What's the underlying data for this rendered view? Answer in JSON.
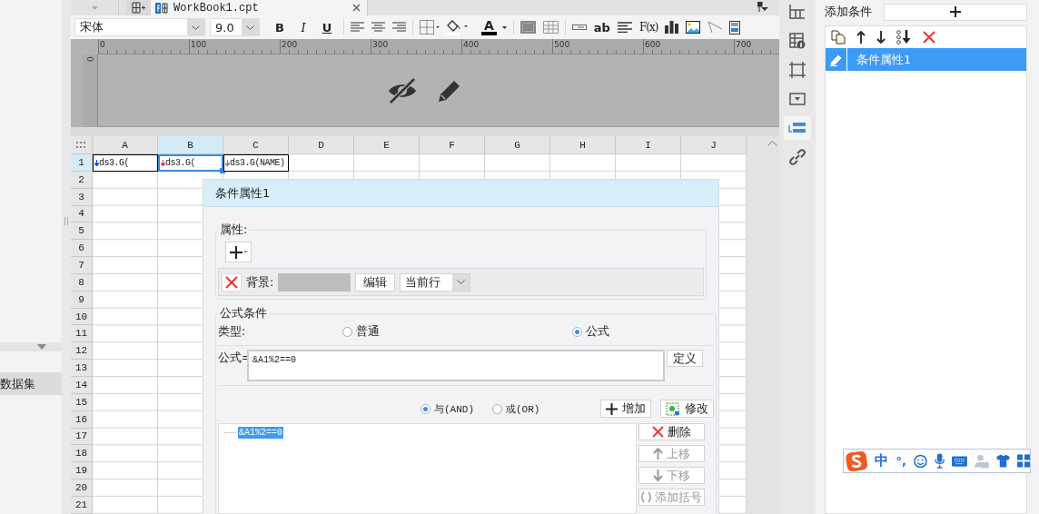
{
  "left_panel": {
    "dataset_label": "数据集"
  },
  "tab_bar": {
    "tabs": [
      {
        "label": "WorkBook1.cpt",
        "selected": true
      }
    ]
  },
  "toolbar": {
    "font": "宋体",
    "font_size": "9.0",
    "format_buttons": [
      {
        "kind": "bold",
        "label": "B"
      },
      {
        "kind": "italic",
        "label": "I"
      },
      {
        "kind": "underline",
        "label": "U"
      }
    ],
    "font_color_label": "A",
    "text_tool_label": "ab",
    "formula_tool_label": "F(x)"
  },
  "ruler": {
    "marks": [
      "0",
      "100",
      "200",
      "300",
      "400",
      "500",
      "600",
      "700"
    ],
    "vertical_mark": "0"
  },
  "sheet": {
    "columns": [
      {
        "label": "A",
        "selected": false
      },
      {
        "label": "B",
        "selected": true
      },
      {
        "label": "C",
        "selected": false
      },
      {
        "label": "D",
        "selected": false
      },
      {
        "label": "E",
        "selected": false
      },
      {
        "label": "F",
        "selected": false
      },
      {
        "label": "G",
        "selected": false
      },
      {
        "label": "H",
        "selected": false
      },
      {
        "label": "I",
        "selected": false
      },
      {
        "label": "J",
        "selected": false
      }
    ],
    "rows": [
      {
        "label": "1",
        "selected": true,
        "cells": [
          {
            "text": "ds3.G(",
            "selected": false,
            "color": "#1f3fd8"
          },
          {
            "text": "ds3.G(",
            "selected": true,
            "color": "#e8344a"
          },
          {
            "text": "ds3.G(NAME)",
            "selected": false,
            "color": "#8a8a8a"
          }
        ]
      },
      {
        "label": "2",
        "selected": false
      },
      {
        "label": "3",
        "selected": false
      },
      {
        "label": "4",
        "selected": false
      },
      {
        "label": "5",
        "selected": false
      },
      {
        "label": "6",
        "selected": false
      },
      {
        "label": "7",
        "selected": false
      },
      {
        "label": "8",
        "selected": false
      },
      {
        "label": "9",
        "selected": false
      },
      {
        "label": "10",
        "selected": false
      },
      {
        "label": "11",
        "selected": false
      },
      {
        "label": "12",
        "selected": false
      },
      {
        "label": "13",
        "selected": false
      },
      {
        "label": "14",
        "selected": false
      },
      {
        "label": "15",
        "selected": false
      },
      {
        "label": "16",
        "selected": false
      },
      {
        "label": "17",
        "selected": false
      },
      {
        "label": "18",
        "selected": false
      },
      {
        "label": "19",
        "selected": false
      },
      {
        "label": "20",
        "selected": false
      },
      {
        "label": "21",
        "selected": false
      }
    ]
  },
  "side_tabs": [
    {
      "kind": "frozen",
      "selected": false
    },
    {
      "kind": "cell-info",
      "selected": false
    },
    {
      "kind": "border",
      "selected": false
    },
    {
      "kind": "widget",
      "selected": false
    },
    {
      "kind": "condition",
      "selected": true
    },
    {
      "kind": "link",
      "selected": false
    }
  ],
  "condition_panel": {
    "add_label": "添加条件",
    "items": [
      {
        "label": "条件属性1",
        "selected": true
      }
    ]
  },
  "dialog": {
    "title": "条件属性1",
    "properties": {
      "legend": "属性:",
      "background_label": "背景:",
      "edit_button": "编辑",
      "scope": "当前行"
    },
    "formula": {
      "legend": "公式条件",
      "type_label": "类型:",
      "type_options": [
        {
          "label": "普通",
          "selected": false
        },
        {
          "label": "公式",
          "selected": true
        }
      ],
      "formula_label": "公式=",
      "value": "&A1%2==0",
      "define_button": "定义",
      "logic_options": [
        {
          "label": "与(AND)",
          "selected": true
        },
        {
          "label": "或(OR)",
          "selected": false
        }
      ],
      "add_button": "增加",
      "modify_button": "修改",
      "conditions": [
        {
          "text": "&A1%2==0",
          "selected": true
        }
      ],
      "side_buttons": [
        {
          "kind": "delete",
          "label": "删除",
          "disabled": false
        },
        {
          "kind": "up",
          "label": "上移",
          "disabled": true
        },
        {
          "kind": "down",
          "label": "下移",
          "disabled": true
        },
        {
          "kind": "bracket",
          "label": "添加括号",
          "disabled": true
        }
      ]
    }
  },
  "ime": {
    "mode": "中",
    "punctuation": "°,"
  }
}
